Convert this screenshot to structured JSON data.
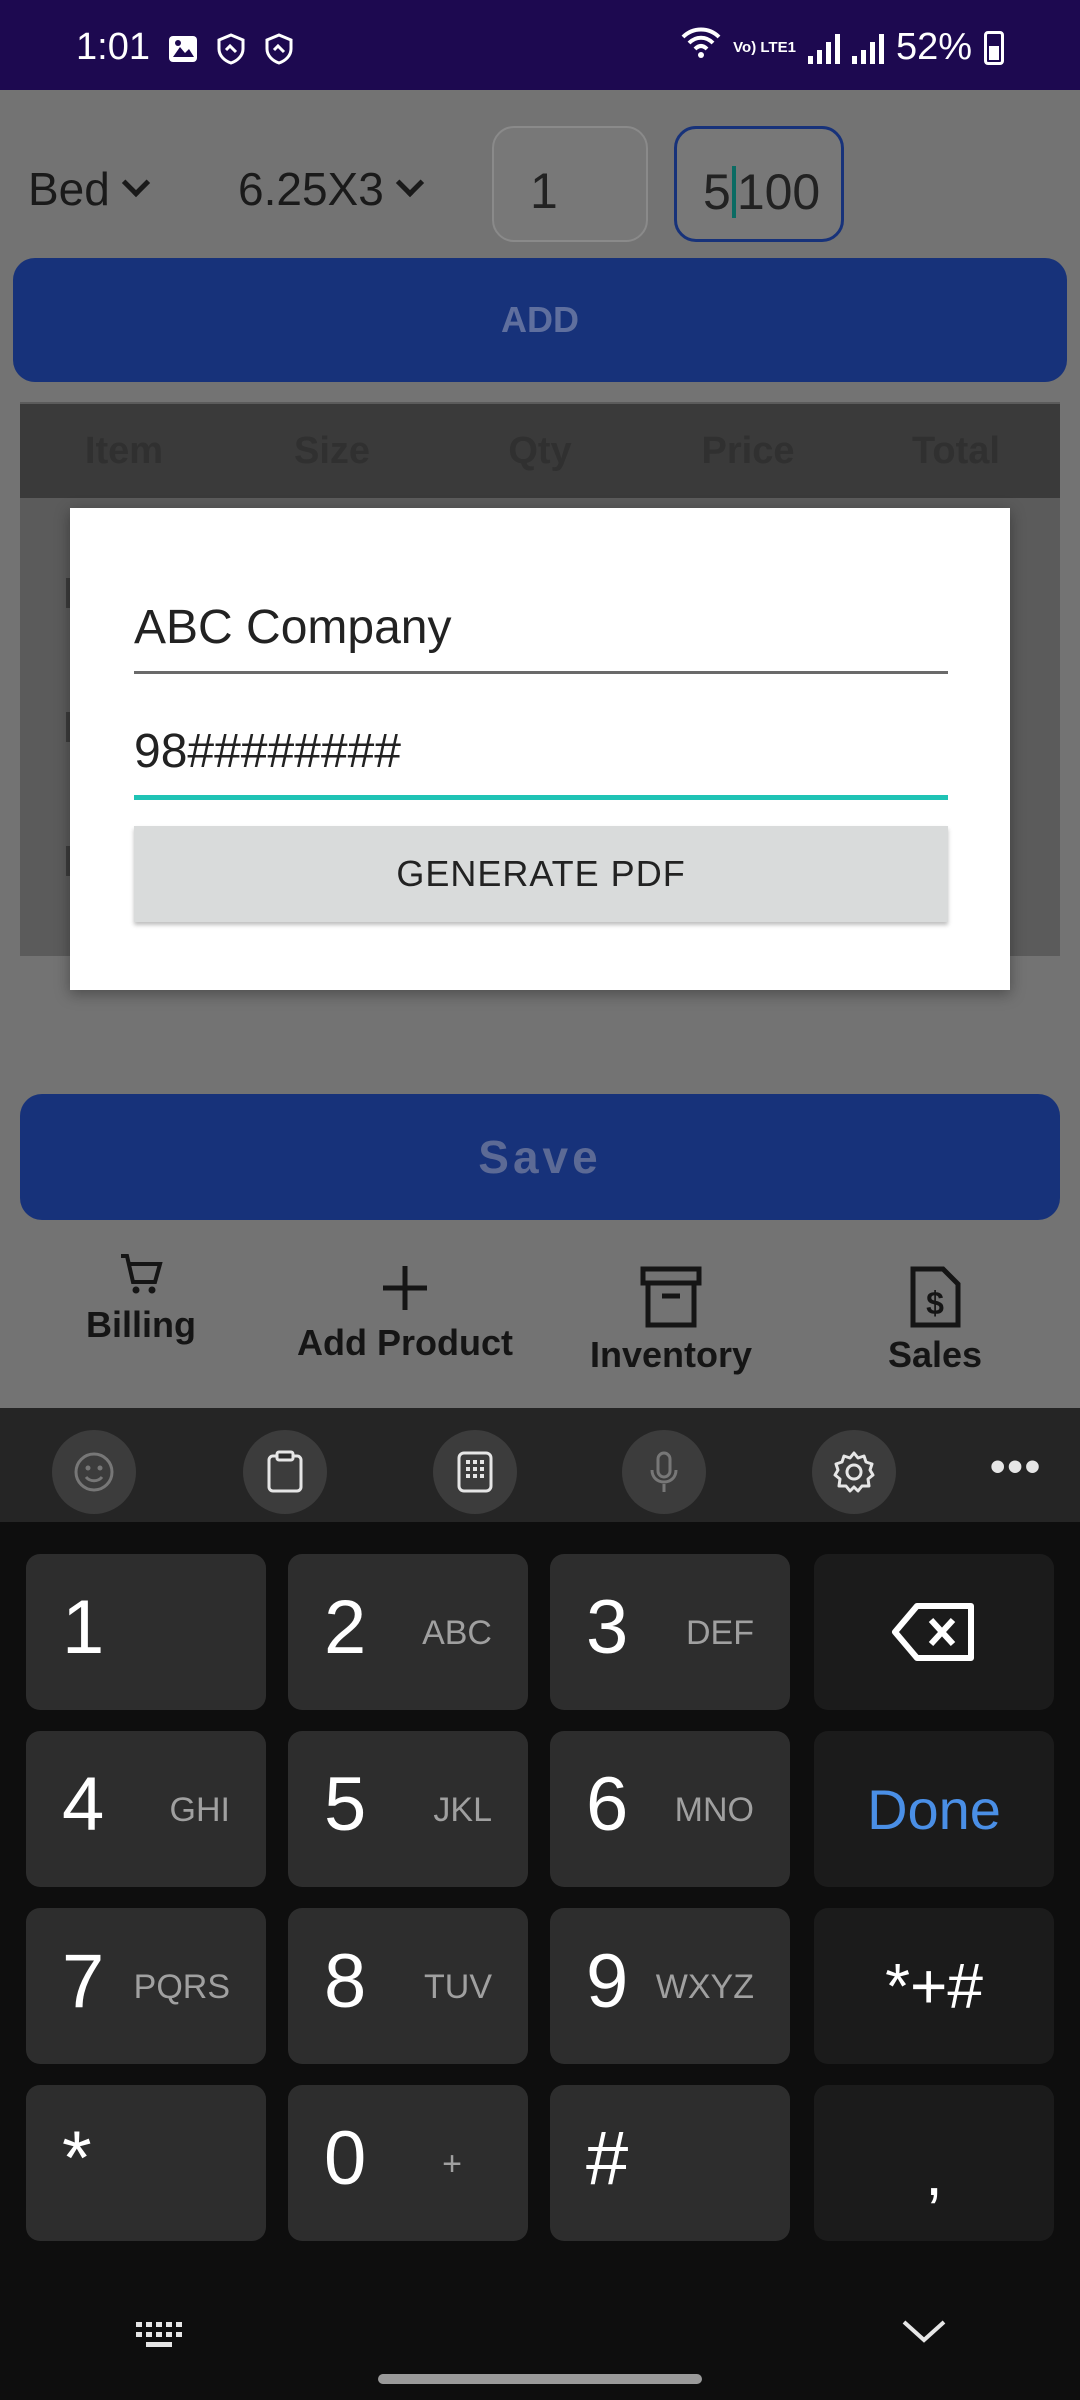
{
  "status_bar": {
    "time": "1:01",
    "battery": "52%",
    "network": "Vo) LTE1"
  },
  "form": {
    "product": "Bed",
    "size": "6.25X3",
    "quantity": "1",
    "price_before_cursor": "5",
    "price_after_cursor": "100",
    "add_label": "ADD"
  },
  "table": {
    "headers": [
      "Item",
      "Size",
      "Qty",
      "Price",
      "Total"
    ]
  },
  "dialog": {
    "name_value": "ABC Company",
    "phone_value": "98########",
    "button_label": "GENERATE PDF"
  },
  "save_label": "Save",
  "nav": [
    {
      "label": "Billing",
      "icon": "cart-icon"
    },
    {
      "label": "Add Product",
      "icon": "plus-icon"
    },
    {
      "label": "Inventory",
      "icon": "archive-icon"
    },
    {
      "label": "Sales",
      "icon": "dollar-file-icon"
    }
  ],
  "keyboard": {
    "toolbar_icons": [
      "emoji-icon",
      "clipboard-icon",
      "keypad-icon",
      "mic-icon",
      "settings-icon",
      "more-icon"
    ],
    "more_label": "•••",
    "keys": [
      {
        "digit": "1",
        "letters": ""
      },
      {
        "digit": "2",
        "letters": "ABC"
      },
      {
        "digit": "3",
        "letters": "DEF"
      },
      {
        "digit": "4",
        "letters": "GHI"
      },
      {
        "digit": "5",
        "letters": "JKL"
      },
      {
        "digit": "6",
        "letters": "MNO"
      },
      {
        "digit": "7",
        "letters": "PQRS"
      },
      {
        "digit": "8",
        "letters": "TUV"
      },
      {
        "digit": "9",
        "letters": "WXYZ"
      },
      {
        "digit": "0",
        "letters": "+"
      }
    ],
    "done_label": "Done",
    "symbols_label": "*+#",
    "star_label": "*",
    "hash_label": "#",
    "comma_label": ","
  },
  "colors": {
    "primary": "#17327a",
    "accent": "#1fc3b5",
    "done": "#4a8fe6",
    "status_bar": "#1d0950"
  }
}
